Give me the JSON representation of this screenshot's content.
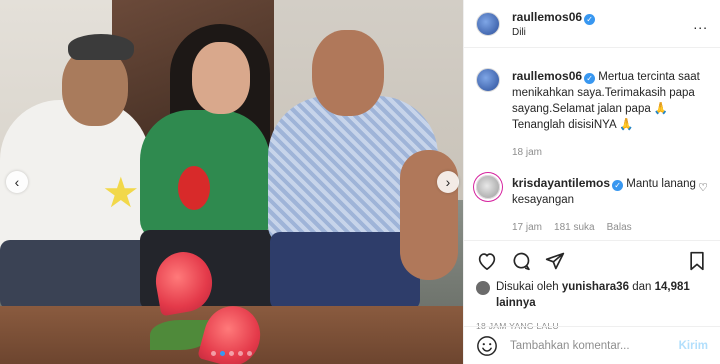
{
  "header": {
    "username": "raullemos06",
    "location": "Dili",
    "more_label": "..."
  },
  "caption": {
    "username": "raullemos06",
    "text": "Mertua tercinta saat menikahkan saya.Terimakasih papa sayang.Selamat jalan papa 🙏 Tenanglah disisiNYA 🙏",
    "time": "18 jam"
  },
  "comments": [
    {
      "username": "krisdayantilemos",
      "text": "Mantu lanang kesayangan",
      "time": "17 jam",
      "likes": "181 suka",
      "reply_label": "Balas"
    }
  ],
  "likes": {
    "prefix": "Disukai oleh",
    "user": "yunishara36",
    "connector": "dan",
    "others": "14,981 lainnya"
  },
  "posted_ago": "18 JAM YANG LALU",
  "add_comment": {
    "placeholder": "Tambahkan komentar...",
    "post_label": "Kirim"
  },
  "carousel": {
    "prev_label": "‹",
    "next_label": "›",
    "count": 5,
    "active_index": 1
  },
  "colors": {
    "verified": "#3897f0",
    "post_button": "#b2dffc"
  },
  "icons": [
    "heart-icon",
    "comment-icon",
    "share-icon",
    "bookmark-icon",
    "emoji-icon",
    "verified-icon"
  ]
}
